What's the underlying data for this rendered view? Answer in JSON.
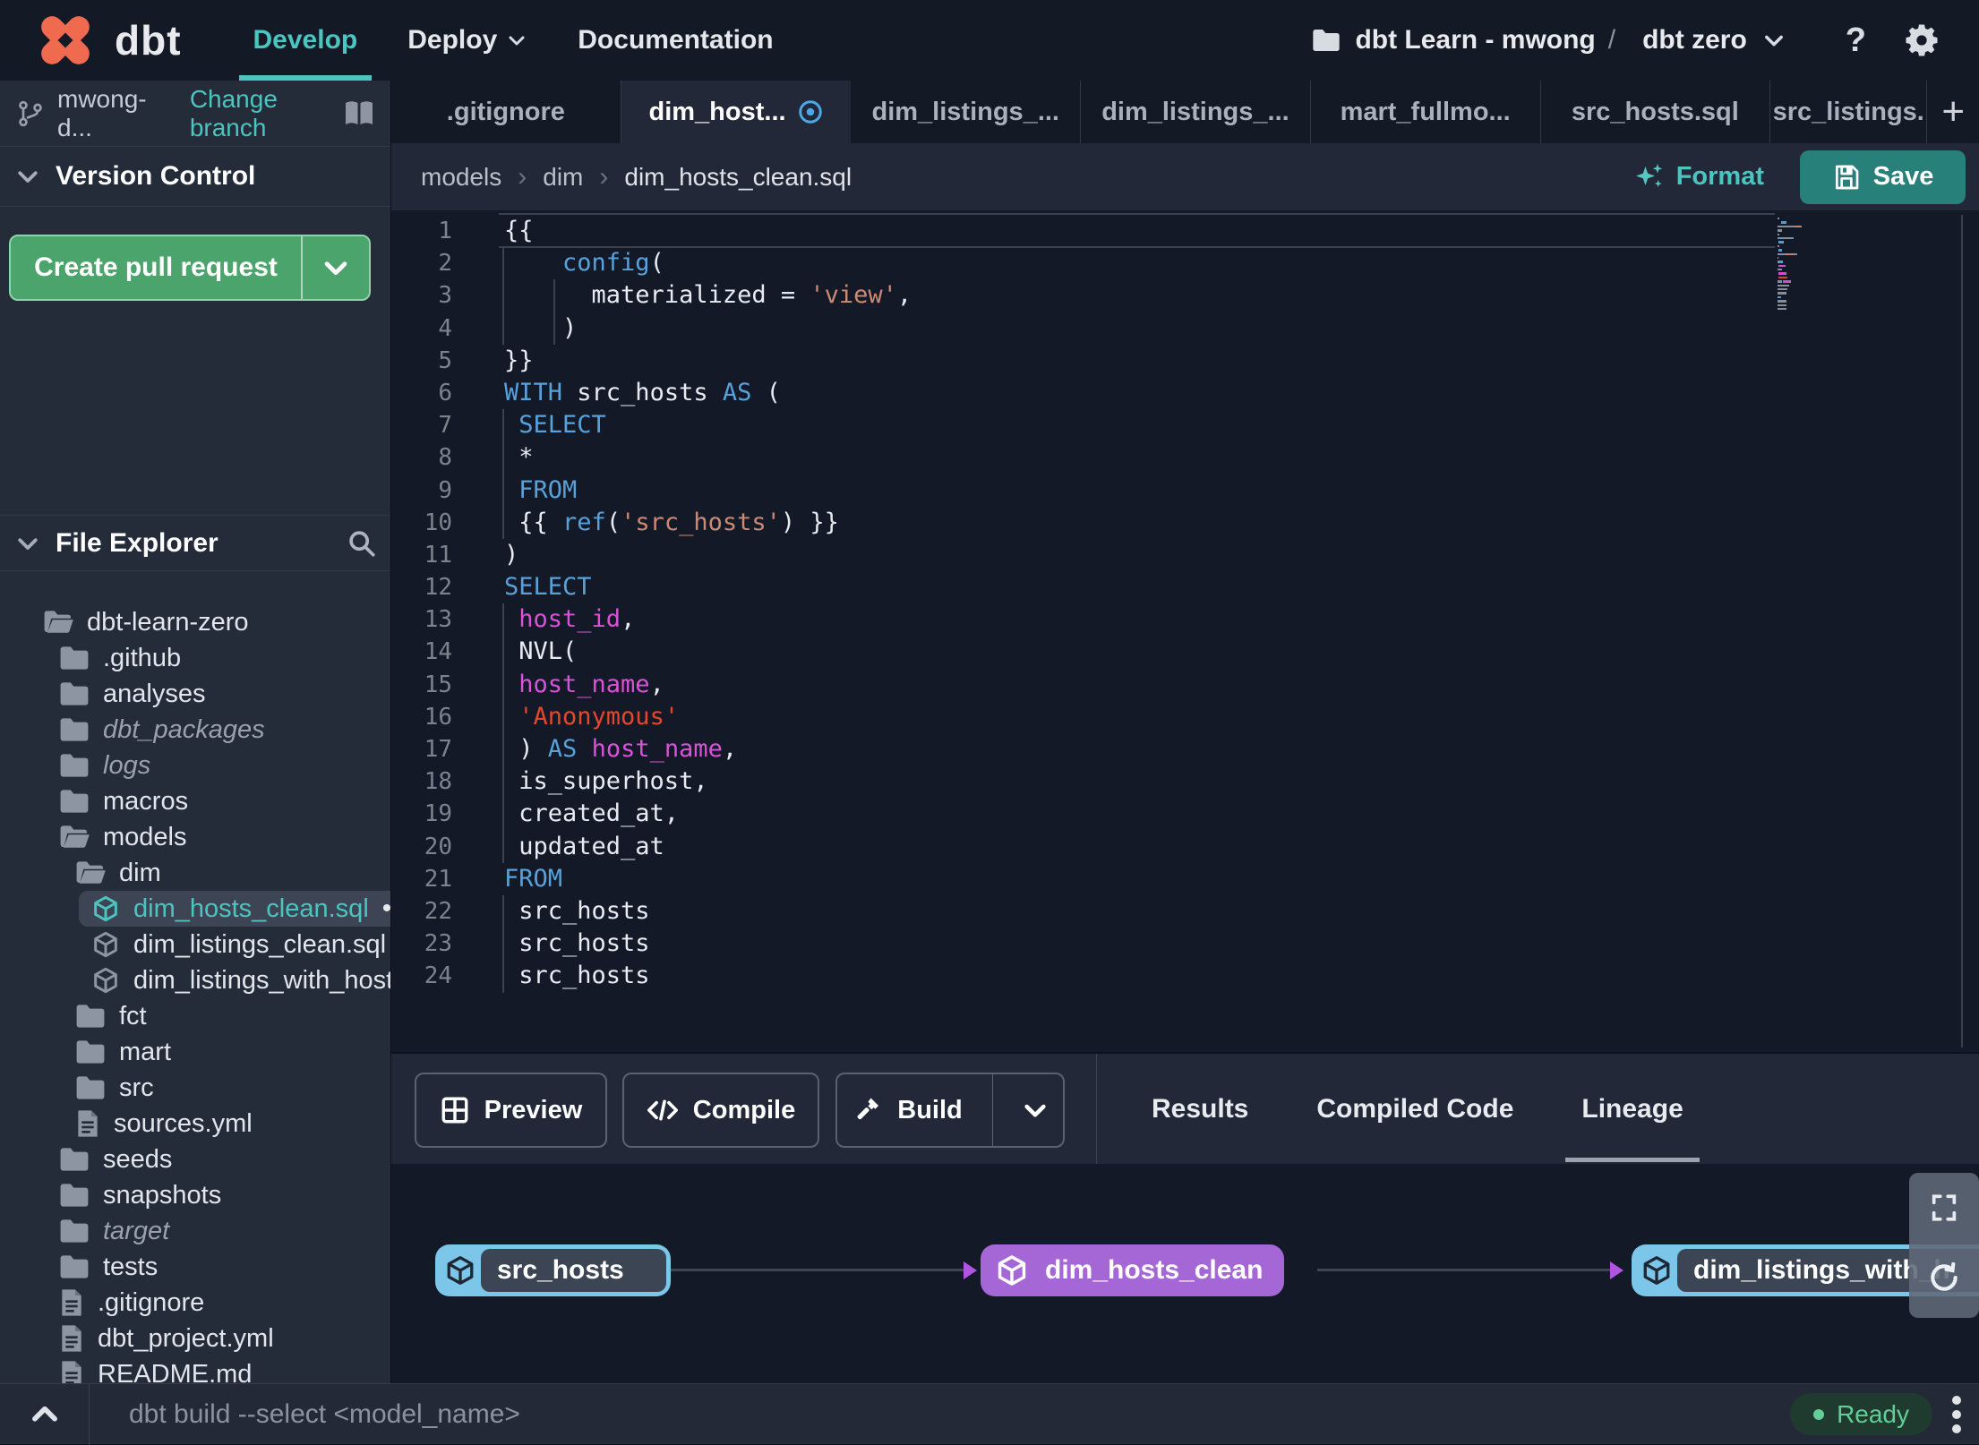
{
  "colors": {
    "accent_teal": "#4cc4c0",
    "logo_orange": "#f06a50",
    "save_button": "#27807a",
    "pr_green": "#4ba46b",
    "pr_green_border": "#8fd2ac",
    "node_blue": "#7cc6e9",
    "node_purple": "#a667d6",
    "edge_arrow": "#b055e0",
    "ready_green": "#62ce96",
    "modified_blue": "#4aa7e8",
    "code_kw": "#58a1da",
    "code_str": "#cd8a72",
    "code_str_alt": "#e5472b",
    "code_ident": "#da52da",
    "code_text": "#e8ebf1"
  },
  "navbar": {
    "brand": "dbt",
    "menu": [
      {
        "label": "Develop",
        "active": true
      },
      {
        "label": "Deploy",
        "chevron": true
      },
      {
        "label": "Documentation"
      }
    ],
    "project": {
      "folder_label": "dbt Learn - mwong",
      "separator": "/",
      "env_label": "dbt zero"
    },
    "help_label": "?"
  },
  "sidebar": {
    "branch": {
      "name": "mwong-d...",
      "change_link": "Change branch"
    },
    "version_control_title": "Version Control",
    "create_pr_label": "Create pull request",
    "file_explorer_title": "File Explorer",
    "tree": [
      {
        "label": "dbt-learn-zero",
        "depth": 0,
        "icon": "folder-open"
      },
      {
        "label": ".github",
        "depth": 1,
        "icon": "folder"
      },
      {
        "label": "analyses",
        "depth": 1,
        "icon": "folder"
      },
      {
        "label": "dbt_packages",
        "depth": 1,
        "icon": "folder",
        "italic": true
      },
      {
        "label": "logs",
        "depth": 1,
        "icon": "folder",
        "italic": true
      },
      {
        "label": "macros",
        "depth": 1,
        "icon": "folder"
      },
      {
        "label": "models",
        "depth": 1,
        "icon": "folder-open"
      },
      {
        "label": "dim",
        "depth": 2,
        "icon": "folder-open"
      },
      {
        "label": "dim_hosts_clean.sql",
        "depth": 3,
        "icon": "model",
        "selected": true,
        "modified": true
      },
      {
        "label": "dim_listings_clean.sql",
        "depth": 3,
        "icon": "model"
      },
      {
        "label": "dim_listings_with_hosts...",
        "depth": 3,
        "icon": "model"
      },
      {
        "label": "fct",
        "depth": 2,
        "icon": "folder"
      },
      {
        "label": "mart",
        "depth": 2,
        "icon": "folder"
      },
      {
        "label": "src",
        "depth": 2,
        "icon": "folder"
      },
      {
        "label": "sources.yml",
        "depth": 2,
        "icon": "file"
      },
      {
        "label": "seeds",
        "depth": 1,
        "icon": "folder"
      },
      {
        "label": "snapshots",
        "depth": 1,
        "icon": "folder"
      },
      {
        "label": "target",
        "depth": 1,
        "icon": "folder",
        "italic": true
      },
      {
        "label": "tests",
        "depth": 1,
        "icon": "folder"
      },
      {
        "label": ".gitignore",
        "depth": 1,
        "icon": "file"
      },
      {
        "label": "dbt_project.yml",
        "depth": 1,
        "icon": "file"
      },
      {
        "label": "README.md",
        "depth": 1,
        "icon": "file"
      }
    ]
  },
  "tabbar": {
    "tabs": [
      {
        "label": ".gitignore"
      },
      {
        "label": "dim_host...",
        "active": true,
        "modified": true
      },
      {
        "label": "dim_listings_..."
      },
      {
        "label": "dim_listings_..."
      },
      {
        "label": "mart_fullmo..."
      },
      {
        "label": "src_hosts.sql"
      },
      {
        "label": "src_listings.",
        "truncated": true
      }
    ],
    "add_label": "+"
  },
  "breadcrumb": {
    "items": [
      "models",
      "dim",
      "dim_hosts_clean.sql"
    ]
  },
  "toolbar": {
    "format_label": "Format",
    "save_label": "Save"
  },
  "editor": {
    "lines": [
      [
        {
          "t": "{{",
          "c": "p"
        }
      ],
      [
        {
          "t": "    ",
          "c": "p"
        },
        {
          "t": "config",
          "c": "k"
        },
        {
          "t": "(",
          "c": "p"
        }
      ],
      [
        {
          "t": "      materialized = ",
          "c": "p"
        },
        {
          "t": "'view'",
          "c": "s"
        },
        {
          "t": ",",
          "c": "p"
        }
      ],
      [
        {
          "t": "    )",
          "c": "p"
        }
      ],
      [
        {
          "t": "}}",
          "c": "p"
        }
      ],
      [
        {
          "t": "WITH",
          "c": "k"
        },
        {
          "t": " src_hosts ",
          "c": "p"
        },
        {
          "t": "AS",
          "c": "k"
        },
        {
          "t": " (",
          "c": "p"
        }
      ],
      [
        {
          "t": " ",
          "c": "p"
        },
        {
          "t": "SELECT",
          "c": "k"
        }
      ],
      [
        {
          "t": " *",
          "c": "p"
        }
      ],
      [
        {
          "t": " ",
          "c": "p"
        },
        {
          "t": "FROM",
          "c": "k"
        }
      ],
      [
        {
          "t": " {{ ",
          "c": "p"
        },
        {
          "t": "ref",
          "c": "k"
        },
        {
          "t": "(",
          "c": "p"
        },
        {
          "t": "'src_hosts'",
          "c": "s"
        },
        {
          "t": ") }}",
          "c": "p"
        }
      ],
      [
        {
          "t": ")",
          "c": "p"
        }
      ],
      [
        {
          "t": "SELECT",
          "c": "k"
        }
      ],
      [
        {
          "t": " ",
          "c": "p"
        },
        {
          "t": "host_id",
          "c": "m"
        },
        {
          "t": ",",
          "c": "p"
        }
      ],
      [
        {
          "t": " NVL(",
          "c": "p"
        }
      ],
      [
        {
          "t": " ",
          "c": "p"
        },
        {
          "t": "host_name",
          "c": "m"
        },
        {
          "t": ",",
          "c": "p"
        }
      ],
      [
        {
          "t": " ",
          "c": "p"
        },
        {
          "t": "'Anonymous'",
          "c": "r"
        }
      ],
      [
        {
          "t": " ) ",
          "c": "p"
        },
        {
          "t": "AS",
          "c": "k"
        },
        {
          "t": " ",
          "c": "p"
        },
        {
          "t": "host_name",
          "c": "m"
        },
        {
          "t": ",",
          "c": "p"
        }
      ],
      [
        {
          "t": " is_superhost,",
          "c": "p"
        }
      ],
      [
        {
          "t": " created_at,",
          "c": "p"
        }
      ],
      [
        {
          "t": " updated_at",
          "c": "p"
        }
      ],
      [
        {
          "t": "FROM",
          "c": "k"
        }
      ],
      [
        {
          "t": " src_hosts",
          "c": "p"
        }
      ],
      [
        {
          "t": " src_hosts",
          "c": "p"
        }
      ],
      [
        {
          "t": " src_hosts",
          "c": "p"
        }
      ]
    ],
    "guides": [
      {
        "col": 0,
        "from": 2,
        "to": 4
      },
      {
        "col": 3.5,
        "from": 3,
        "to": 4
      },
      {
        "col": 0,
        "from": 7,
        "to": 10
      },
      {
        "col": 0,
        "from": 13,
        "to": 20
      },
      {
        "col": 0,
        "from": 22,
        "to": 24
      }
    ]
  },
  "actionbar": {
    "preview_label": "Preview",
    "compile_label": "Compile",
    "build_label": "Build",
    "results_tabs": [
      {
        "label": "Results"
      },
      {
        "label": "Compiled Code"
      },
      {
        "label": "Lineage",
        "active": true
      }
    ]
  },
  "lineage": {
    "nodes": [
      {
        "label": "src_hosts",
        "style": "source"
      },
      {
        "label": "dim_hosts_clean",
        "style": "model"
      },
      {
        "label": "dim_listings_with_h",
        "style": "source"
      }
    ]
  },
  "statusbar": {
    "command_placeholder": "dbt build --select <model_name>",
    "status_label": "Ready"
  }
}
